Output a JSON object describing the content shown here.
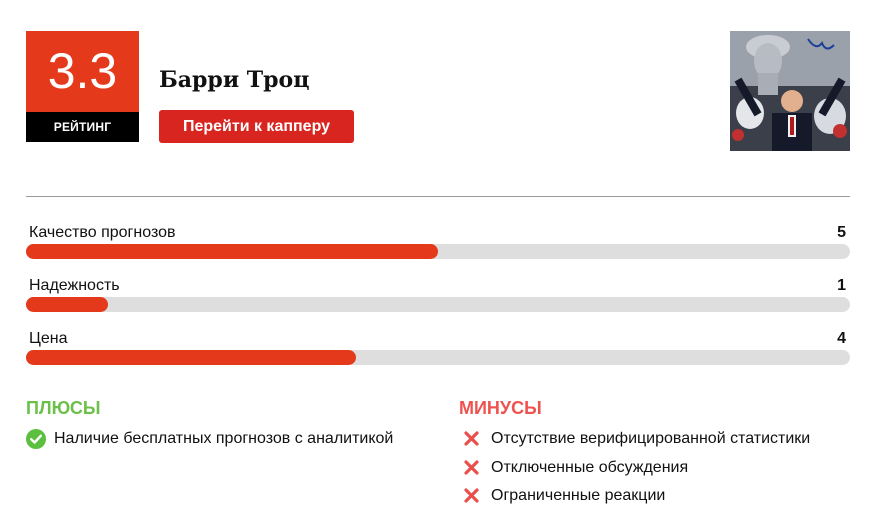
{
  "rating": {
    "value": "3.3",
    "label": "РЕЙТИНГ"
  },
  "tipster": {
    "name": "Барри Троц",
    "button_label": "Перейти к капперу"
  },
  "metrics": [
    {
      "label": "Качество прогнозов",
      "value": "5",
      "fill": 0.5
    },
    {
      "label": "Надежность",
      "value": "1",
      "fill": 0.1
    },
    {
      "label": "Цена",
      "value": "4",
      "fill": 0.4
    }
  ],
  "pros": {
    "title": "ПЛЮСЫ",
    "items": [
      "Наличие бесплатных прогнозов с аналитикой"
    ]
  },
  "cons": {
    "title": "МИНУСЫ",
    "items": [
      "Отсутствие верифицированной статистики",
      "Отключенные обсуждения",
      "Ограниченные реакции"
    ]
  },
  "colors": {
    "accent": "#e5391c",
    "button": "#d8251f",
    "pros": "#6cc04a",
    "cons": "#ef5350",
    "track": "#dedede"
  }
}
